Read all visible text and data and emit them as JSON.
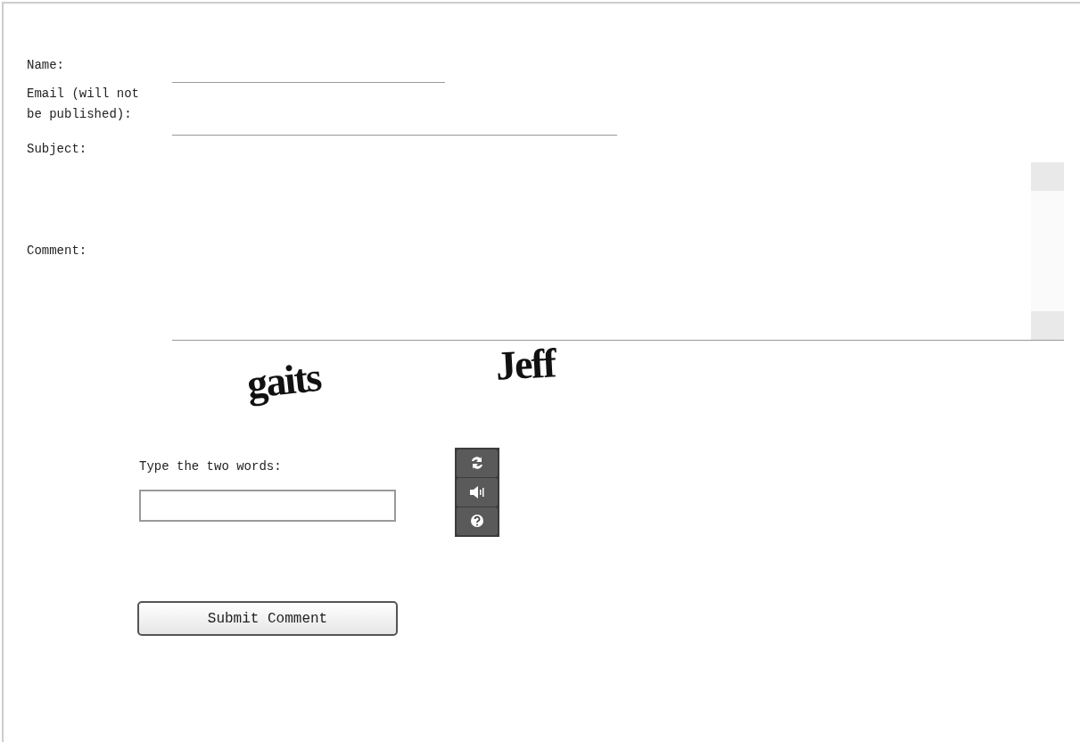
{
  "fields": [
    {
      "label": "Name:",
      "kind": "line"
    },
    {
      "label": "Email (will not be published):",
      "kind": "line"
    },
    {
      "label": "Subject:",
      "kind": "plain"
    },
    {
      "label": "Comment:",
      "kind": "area"
    }
  ],
  "captcha": {
    "words": [
      "gaits",
      "Jeff"
    ],
    "prompt": "Type the two words:"
  },
  "submit": "Submit Comment"
}
